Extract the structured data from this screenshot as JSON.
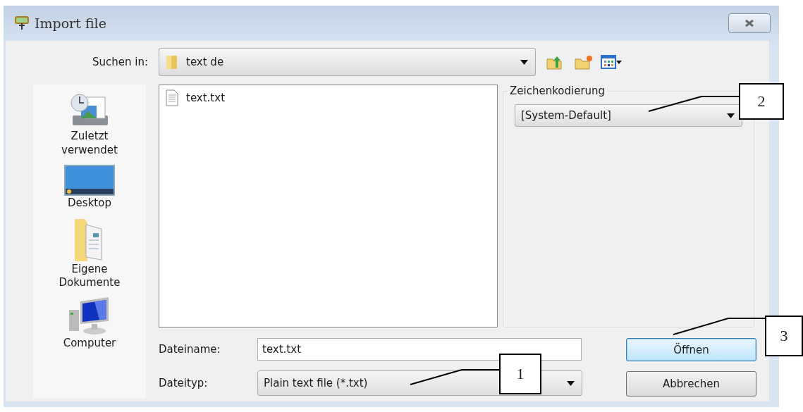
{
  "window": {
    "title": "Import file"
  },
  "look_in": {
    "label": "Suchen in:",
    "value": "text de"
  },
  "places": [
    {
      "kind": "recent",
      "label": "Zuletzt verwendet"
    },
    {
      "kind": "desktop",
      "label": "Desktop"
    },
    {
      "kind": "documents",
      "label": "Eigene Dokumente"
    },
    {
      "kind": "computer",
      "label": "Computer"
    }
  ],
  "files": [
    {
      "name": "text.txt"
    }
  ],
  "encoding": {
    "label": "Zeichenkodierung",
    "value": "[System-Default]"
  },
  "file_name": {
    "label": "Dateiname:",
    "value": "text.txt"
  },
  "file_type": {
    "label": "Dateityp:",
    "value": "Plain text file (*.txt)"
  },
  "buttons": [
    {
      "label": "Öffnen",
      "default": true
    },
    {
      "label": "Abbrechen",
      "default": false
    }
  ],
  "callouts": [
    {
      "number": "2"
    },
    {
      "number": "3"
    },
    {
      "number": "1"
    }
  ]
}
